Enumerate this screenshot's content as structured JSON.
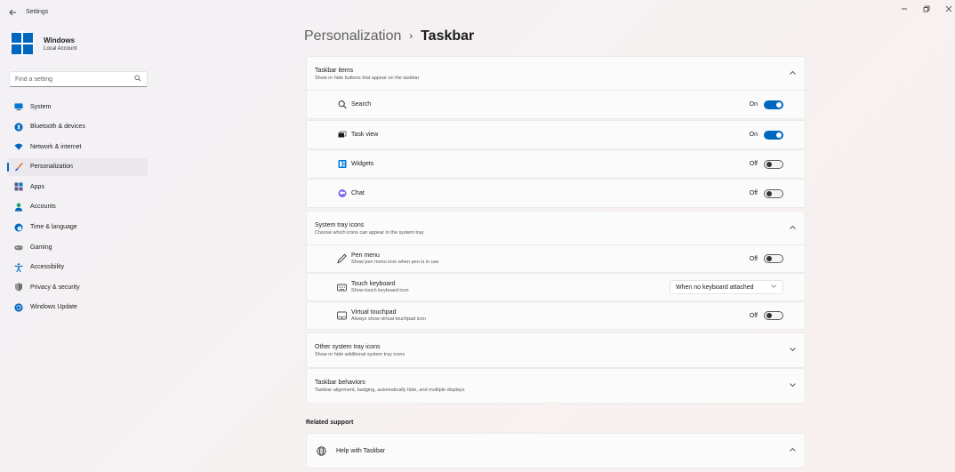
{
  "window": {
    "title": "Settings"
  },
  "account": {
    "name": "Windows",
    "type": "Local Account"
  },
  "search": {
    "placeholder": "Find a setting"
  },
  "nav": [
    {
      "label": "System",
      "icon": "monitor-icon",
      "color": "#0078d4"
    },
    {
      "label": "Bluetooth & devices",
      "icon": "bluetooth-icon",
      "color": "#0067c0"
    },
    {
      "label": "Network & internet",
      "icon": "wifi-icon",
      "color": "#0067c0"
    },
    {
      "label": "Personalization",
      "icon": "brush-icon",
      "color": "#e37b31",
      "selected": true
    },
    {
      "label": "Apps",
      "icon": "apps-icon",
      "color": "#5a5a82"
    },
    {
      "label": "Accounts",
      "icon": "person-icon",
      "color": "#1aa36c"
    },
    {
      "label": "Time & language",
      "icon": "globe-clock-icon",
      "color": "#0067c0"
    },
    {
      "label": "Gaming",
      "icon": "gamepad-icon",
      "color": "#6b6b6b"
    },
    {
      "label": "Accessibility",
      "icon": "accessibility-icon",
      "color": "#0067c0"
    },
    {
      "label": "Privacy & security",
      "icon": "shield-icon",
      "color": "#6e6e6e"
    },
    {
      "label": "Windows Update",
      "icon": "update-icon",
      "color": "#0067c0"
    }
  ],
  "header": {
    "parent": "Personalization",
    "separator": "›",
    "current": "Taskbar"
  },
  "taskbar_items": {
    "title": "Taskbar items",
    "desc": "Show or hide buttons that appear on the taskbar",
    "rows": [
      {
        "label": "Search",
        "state": "On",
        "on": true
      },
      {
        "label": "Task view",
        "state": "On",
        "on": true
      },
      {
        "label": "Widgets",
        "state": "Off",
        "on": false
      },
      {
        "label": "Chat",
        "state": "Off",
        "on": false
      }
    ]
  },
  "system_tray": {
    "title": "System tray icons",
    "desc": "Choose which icons can appear in the system tray",
    "pen_menu": {
      "label": "Pen menu",
      "desc": "Show pen menu icon when pen is in use",
      "state": "Off"
    },
    "touch_keyboard": {
      "label": "Touch keyboard",
      "desc": "Show touch keyboard icon",
      "value": "When no keyboard attached"
    },
    "virtual_touchpad": {
      "label": "Virtual touchpad",
      "desc": "Always show virtual touchpad icon",
      "state": "Off"
    }
  },
  "other_tray": {
    "title": "Other system tray icons",
    "desc": "Show or hide additional system tray icons"
  },
  "behaviors": {
    "title": "Taskbar behaviors",
    "desc": "Taskbar alignment, badging, automatically hide, and multiple displays"
  },
  "related": {
    "title": "Related support",
    "help_label": "Help with Taskbar"
  }
}
